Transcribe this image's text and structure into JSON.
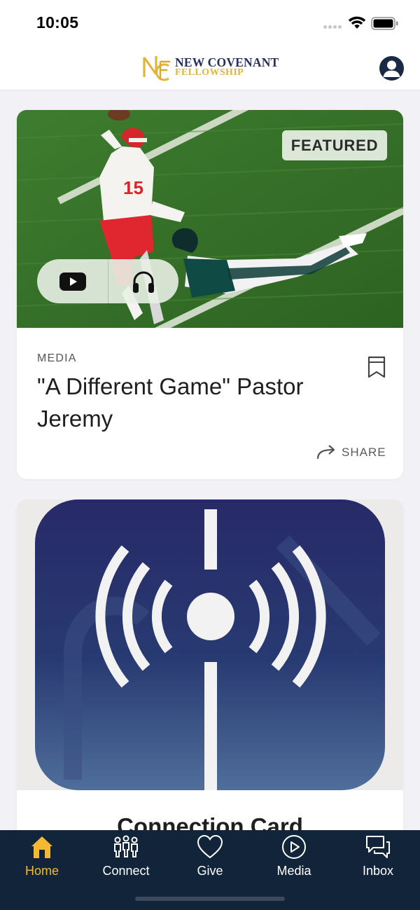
{
  "status_bar": {
    "time": "10:05"
  },
  "header": {
    "logo_initials": "NCF",
    "logo_line1": "NEW COVENANT",
    "logo_line2": "FELLOWSHIP"
  },
  "featured_card": {
    "badge": "FEATURED",
    "category": "MEDIA",
    "title": "\"A Different Game\" Pastor Jeremy",
    "share_label": "SHARE",
    "watch_icon": "youtube-play-icon",
    "listen_icon": "headphones-icon"
  },
  "second_card": {
    "title": "Connection Card"
  },
  "tabs": [
    {
      "label": "Home",
      "icon": "home-icon",
      "active": true
    },
    {
      "label": "Connect",
      "icon": "people-icon",
      "active": false
    },
    {
      "label": "Give",
      "icon": "heart-icon",
      "active": false
    },
    {
      "label": "Media",
      "icon": "play-circle-icon",
      "active": false
    },
    {
      "label": "Inbox",
      "icon": "chat-bubbles-icon",
      "active": false
    }
  ],
  "colors": {
    "tabbar_bg": "#12243a",
    "active_tab": "#f5b833",
    "brand_navy": "#25305e",
    "brand_gold": "#e0b53c",
    "broadcast_bg": "#2a2f6a"
  }
}
